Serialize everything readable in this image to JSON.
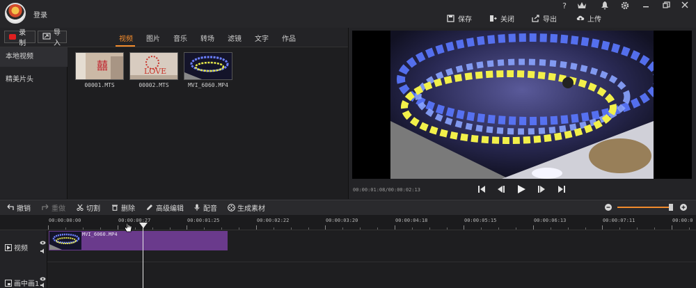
{
  "header": {
    "login_label": "登录",
    "actions": [
      {
        "icon": "save-icon",
        "label": "保存"
      },
      {
        "icon": "close-door-icon",
        "label": "关闭"
      },
      {
        "icon": "export-icon",
        "label": "导出"
      },
      {
        "icon": "upload-icon",
        "label": "上传"
      }
    ],
    "help": "?"
  },
  "left_panel": {
    "record_label": "录制",
    "import_label": "导入",
    "tabs": [
      "视频",
      "图片",
      "音乐",
      "转场",
      "滤镜",
      "文字",
      "作品"
    ],
    "active_tab": "视频",
    "sidebar": [
      "本地视频",
      "精美片头"
    ],
    "files": [
      "00001.MTS",
      "00002.MTS",
      "MVI_6060.MP4"
    ]
  },
  "preview": {
    "timecode": "00:00:01:08/00:00:02:13"
  },
  "toolbar": {
    "undo": "撤销",
    "redo": "重做",
    "cut": "切割",
    "delete": "删除",
    "advanced_edit": "高级编辑",
    "dub": "配音",
    "generate": "生成素材"
  },
  "timeline": {
    "ruler_labels": [
      "00:00:00:00",
      "00:00:00:27",
      "00:00:01:25",
      "00:00:02:22",
      "00:00:03:20",
      "00:00:04:18",
      "00:00:05:15",
      "00:00:06:13",
      "00:00:07:11",
      "00:00:0"
    ],
    "tracks": [
      "视频",
      "画中画1"
    ],
    "clip_name": "MVI_6060.MP4"
  },
  "colors": {
    "accent": "#f28b2c",
    "clip": "#6a3a8c",
    "record": "#e02020"
  }
}
